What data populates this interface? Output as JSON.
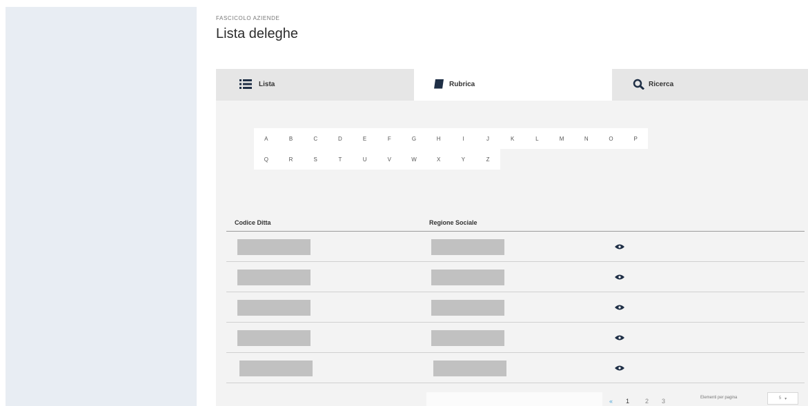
{
  "header": {
    "eyebrow": "FASCICOLO AZIENDE",
    "title": "Lista deleghe"
  },
  "tabs": [
    {
      "label": "Lista",
      "icon": "list-icon"
    },
    {
      "label": "Rubrica",
      "icon": "book-icon"
    },
    {
      "label": "Ricerca",
      "icon": "search-icon"
    }
  ],
  "alphabet": {
    "row1": [
      "A",
      "B",
      "C",
      "D",
      "E",
      "F",
      "G",
      "H",
      "I",
      "J",
      "K",
      "L",
      "M",
      "N",
      "O",
      "P"
    ],
    "row2": [
      "Q",
      "R",
      "S",
      "T",
      "U",
      "V",
      "W",
      "X",
      "Y",
      "Z"
    ]
  },
  "table": {
    "columns": [
      "Codice Ditta",
      "Regione Sociale",
      ""
    ],
    "rows": [
      {
        "codice": "",
        "ragione": "",
        "action_icon": "eye-icon"
      },
      {
        "codice": "",
        "ragione": "",
        "action_icon": "eye-icon"
      },
      {
        "codice": "",
        "ragione": "",
        "action_icon": "eye-icon"
      },
      {
        "codice": "",
        "ragione": "",
        "action_icon": "eye-icon"
      },
      {
        "codice": "",
        "ragione": "",
        "action_icon": "eye-icon"
      }
    ]
  },
  "pagination": {
    "prev": "«",
    "pages": [
      "1",
      "2",
      "3"
    ],
    "current": "1",
    "per_page_label": "Elementi per pagina",
    "per_page_value": "5"
  },
  "colors": {
    "sidebar": "#e8edf3",
    "tab_inactive": "#e6e6e6",
    "panel": "#f3f3f3",
    "placeholder": "#c1c1c1",
    "icon": "#1f2f46"
  }
}
